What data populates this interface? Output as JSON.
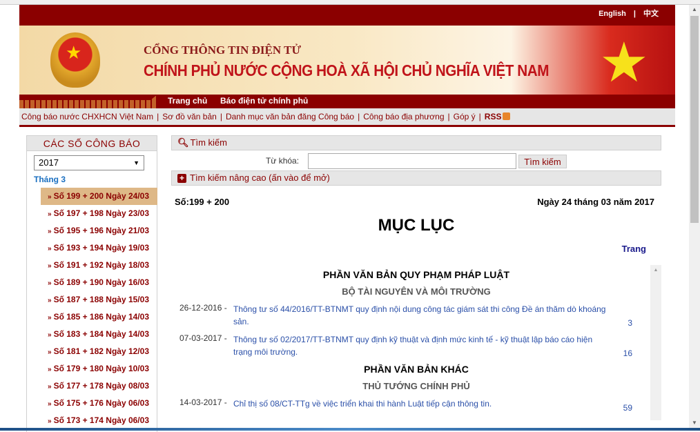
{
  "header": {
    "lang_english": "English",
    "lang_sep": "|",
    "lang_chinese": "中文",
    "title_line1": "CỔNG THÔNG TIN ĐIỆN TỬ",
    "title_line2": "CHÍNH PHỦ NƯỚC CỘNG HOÀ XÃ HỘI CHỦ NGHĨA VIỆT NAM"
  },
  "nav": {
    "items": [
      "Trang chủ",
      "Báo điện tử chính phủ"
    ]
  },
  "links": {
    "items": [
      "Công báo nước CHXHCN Việt Nam",
      "Sơ đồ văn bản",
      "Danh mục văn bản đăng Công báo",
      "Công báo địa phương",
      "Góp ý",
      "RSS"
    ],
    "sep": "|"
  },
  "sidebar": {
    "title": "CÁC SỐ CÔNG BÁO",
    "year": "2017",
    "month": "Tháng 3",
    "bullet": "»",
    "issues": [
      "Số 199 + 200 Ngày 24/03",
      "Số 197 + 198 Ngày 23/03",
      "Số 195 + 196 Ngày 21/03",
      "Số 193 + 194 Ngày 19/03",
      "Số 191 + 192 Ngày 18/03",
      "Số 189 + 190 Ngày 16/03",
      "Số 187 + 188 Ngày 15/03",
      "Số 185 + 186 Ngày 14/03",
      "Số 183 + 184 Ngày 14/03",
      "Số 181 + 182 Ngày 12/03",
      "Số 179 + 180 Ngày 10/03",
      "Số 177 + 178 Ngày 08/03",
      "Số 175 + 176 Ngày 06/03",
      "Số 173 + 174 Ngày 06/03"
    ]
  },
  "search": {
    "title": "Tìm kiếm",
    "keyword_label": "Từ khóa:",
    "keyword_value": "",
    "button": "Tìm kiếm",
    "advanced": "Tìm kiếm nâng cao (ấn vào để mở)"
  },
  "issue": {
    "number": "Số:199 + 200",
    "date": "Ngày 24 tháng 03 năm 2017",
    "heading": "MỤC LỤC",
    "page_col": "Trang"
  },
  "toc": {
    "sec1": "PHẦN VĂN BẢN QUY PHẠM PHÁP LUẬT",
    "org1": "BỘ TÀI NGUYÊN VÀ MÔI TRƯỜNG",
    "entries1": [
      {
        "date": "26-12-2016 -",
        "title": "Thông tư số 44/2016/TT-BTNMT quy định nội dung công tác giám sát thi công Đề án thăm dò khoáng sản.",
        "page": "3"
      },
      {
        "date": "07-03-2017 -",
        "title": "Thông tư số 02/2017/TT-BTNMT quy định kỹ thuật và định mức kinh tế - kỹ thuật lập báo cáo hiện trạng môi trường.",
        "page": "16"
      }
    ],
    "sec2": "PHẦN VĂN BẢN KHÁC",
    "org2": "THỦ TƯỚNG CHÍNH PHỦ",
    "entries2": [
      {
        "date": "14-03-2017 -",
        "title": "Chỉ thị số 08/CT-TTg về việc triển khai thi hành Luật tiếp cận thông tin.",
        "page": "59"
      }
    ]
  },
  "colors": {
    "brand": "#8b0000",
    "selected": "#deb887",
    "link": "#2a4fa8"
  }
}
